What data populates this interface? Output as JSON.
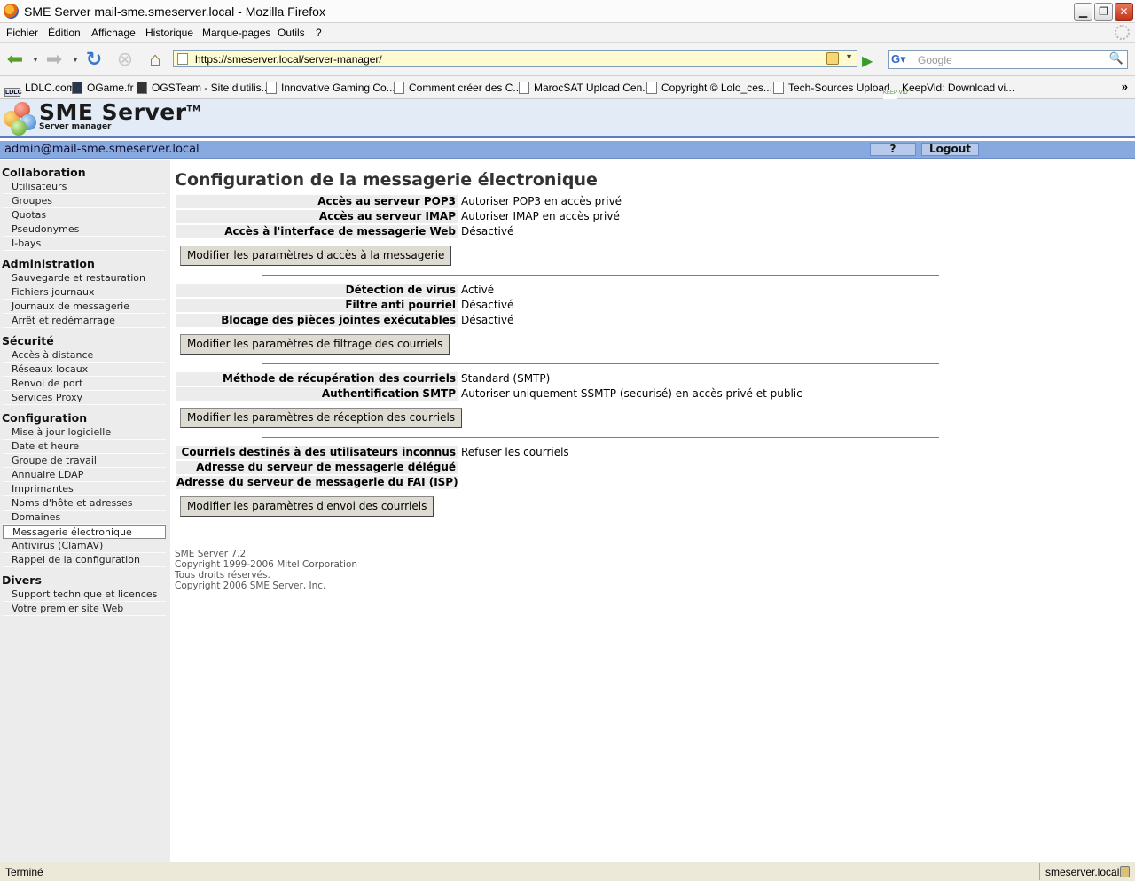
{
  "window": {
    "title": "SME Server mail-sme.smeserver.local - Mozilla Firefox"
  },
  "menu": [
    "Fichier",
    "Édition",
    "Affichage",
    "Historique",
    "Marque-pages",
    "Outils",
    "?"
  ],
  "nav": {
    "url": "https://smeserver.local/server-manager/",
    "search_placeholder": "Google"
  },
  "bookmarks": [
    "LDLC.com",
    "OGame.fr",
    "OGSTeam - Site d'utilis...",
    "Innovative Gaming Co...",
    "Comment créer des C...",
    "MarocSAT Upload Cen...",
    "Copyright © Lolo_ces...",
    "Tech-Sources Upload",
    "KeepVid: Download vi..."
  ],
  "bookmark_icon_texts": {
    "ldlc": "LDLC",
    "keepvid": "KEEP VID"
  },
  "header": {
    "logo": "SME Server",
    "logo_tm": "TM",
    "subtitle": "Server manager"
  },
  "userbar": {
    "user": "admin@mail-sme.smeserver.local",
    "help": "?",
    "logout": "Logout"
  },
  "sidebar": {
    "sections": [
      {
        "title": "Collaboration",
        "items": [
          "Utilisateurs",
          "Groupes",
          "Quotas",
          "Pseudonymes",
          "I-bays"
        ]
      },
      {
        "title": "Administration",
        "items": [
          "Sauvegarde et restauration",
          "Fichiers journaux",
          "Journaux de messagerie",
          "Arrêt et redémarrage"
        ]
      },
      {
        "title": "Sécurité",
        "items": [
          "Accès à distance",
          "Réseaux locaux",
          "Renvoi de port",
          "Services Proxy"
        ]
      },
      {
        "title": "Configuration",
        "items": [
          "Mise à jour logicielle",
          "Date et heure",
          "Groupe de travail",
          "Annuaire LDAP",
          "Imprimantes",
          "Noms d'hôte et adresses",
          "Domaines",
          "Messagerie électronique",
          "Antivirus (ClamAV)",
          "Rappel de la configuration"
        ]
      },
      {
        "title": "Divers",
        "items": [
          "Support technique et licences",
          "Votre premier site Web"
        ]
      }
    ],
    "active": "Messagerie électronique"
  },
  "content": {
    "title": "Configuration de la messagerie électronique",
    "groups": [
      {
        "rows": [
          {
            "label": "Accès au serveur POP3",
            "value": "Autoriser POP3 en accès privé"
          },
          {
            "label": "Accès au serveur IMAP",
            "value": "Autoriser IMAP en accès privé"
          },
          {
            "label": "Accès à l'interface de messagerie Web",
            "value": "Désactivé"
          }
        ],
        "button": "Modifier les paramètres d'accès à la messagerie"
      },
      {
        "rows": [
          {
            "label": "Détection de virus",
            "value": "Activé"
          },
          {
            "label": "Filtre anti pourriel",
            "value": "Désactivé"
          },
          {
            "label": "Blocage des pièces jointes exécutables",
            "value": "Désactivé"
          }
        ],
        "button": "Modifier les paramètres de filtrage des courriels"
      },
      {
        "rows": [
          {
            "label": "Méthode de récupération des courriels",
            "value": "Standard (SMTP)"
          },
          {
            "label": "Authentification SMTP",
            "value": "Autoriser uniquement SSMTP (securisé) en accès privé et public"
          }
        ],
        "button": "Modifier les paramètres de réception des courriels"
      },
      {
        "rows": [
          {
            "label": "Courriels destinés à des utilisateurs inconnus",
            "value": "Refuser les courriels"
          },
          {
            "label": "Adresse du serveur de messagerie délégué",
            "value": ""
          },
          {
            "label": "Adresse du serveur de messagerie du FAI (ISP)",
            "value": ""
          }
        ],
        "button": "Modifier les paramètres d'envoi des courriels"
      }
    ],
    "footer": [
      "SME Server 7.2",
      "Copyright 1999-2006 Mitel Corporation",
      "Tous droits réservés.",
      "Copyright 2006 SME Server, Inc."
    ]
  },
  "statusbar": {
    "status": "Terminé",
    "host": "smeserver.local"
  }
}
